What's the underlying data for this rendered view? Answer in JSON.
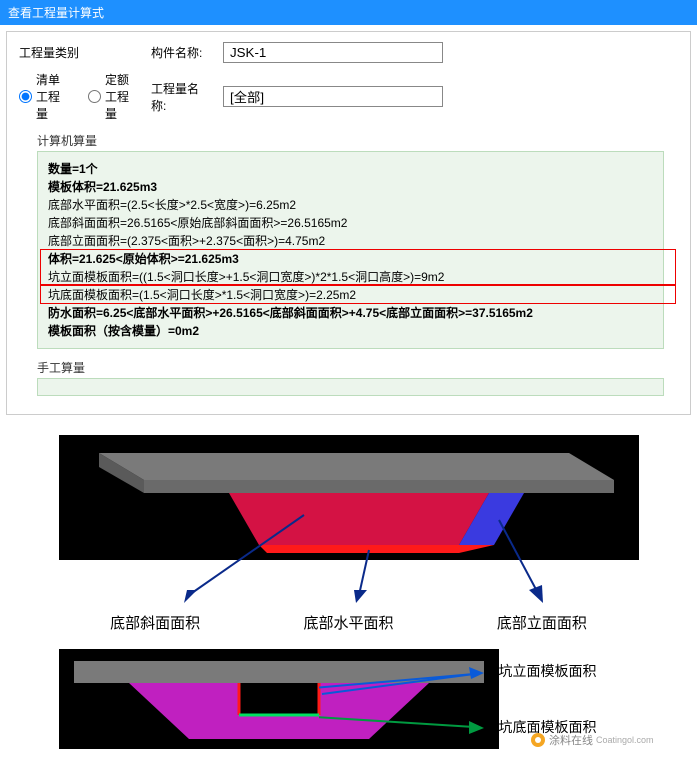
{
  "window": {
    "title": "查看工程量计算式"
  },
  "form": {
    "category_label": "工程量类别",
    "radio_bill": "清单工程量",
    "radio_quota": "定额工程量",
    "component_name_label": "构件名称:",
    "component_name_value": "JSK-1",
    "project_name_label": "工程量名称:",
    "project_name_value": "[全部]"
  },
  "sections": {
    "computer_calc": "计算机算量",
    "manual_calc": "手工算量"
  },
  "calc_lines": [
    "数量=1个",
    "模板体积=21.625m3",
    "底部水平面积=(2.5<长度>*2.5<宽度>)=6.25m2",
    "底部斜面面积=26.5165<原始底部斜面面积>=26.5165m2",
    "底部立面面积=(2.375<面积>+2.375<面积>)=4.75m2",
    "体积=21.625<原始体积>=21.625m3",
    "坑立面模板面积=((1.5<洞口长度>+1.5<洞口宽度>)*2*1.5<洞口高度>)=9m2",
    "坑底面模板面积=(1.5<洞口长度>*1.5<洞口宽度>)=2.25m2",
    "防水面积=6.25<底部水平面积>+26.5165<底部斜面面积>+4.75<底部立面面积>=37.5165m2",
    "模板面积（按含模量）=0m2"
  ],
  "diagram1": {
    "label_slope": "底部斜面面积",
    "label_horizontal": "底部水平面积",
    "label_vertical": "底部立面面积"
  },
  "diagram2": {
    "label_wall": "坑立面模板面积",
    "label_bottom": "坑底面模板面积"
  },
  "watermark": {
    "text": "涂料在线",
    "url": "Coatingol.com"
  }
}
